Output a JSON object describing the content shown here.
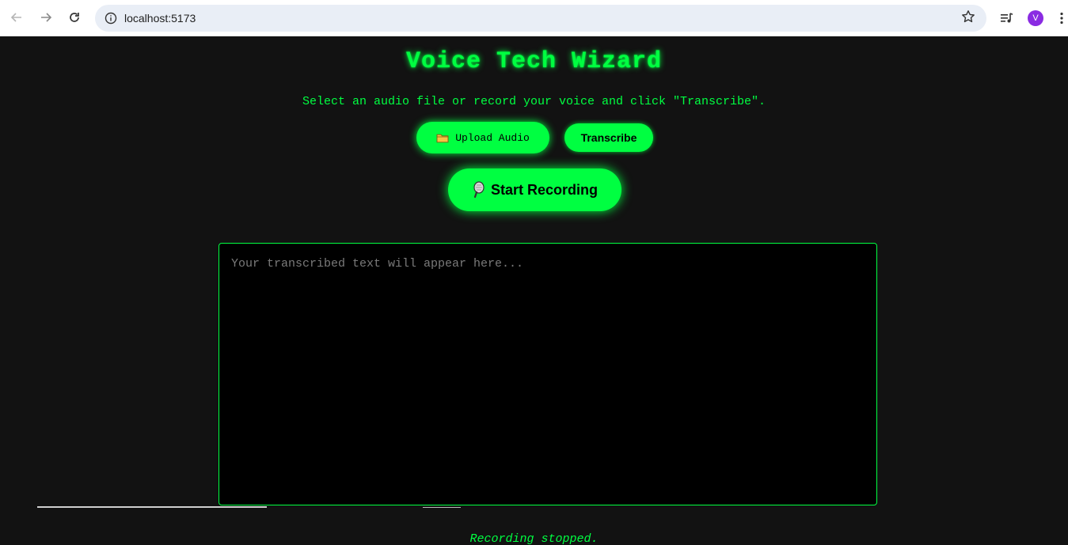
{
  "browser": {
    "url": "localhost:5173",
    "avatar_letter": "V"
  },
  "app": {
    "title": "Voice Tech Wizard",
    "subtitle": "Select an audio file or record your voice and click \"Transcribe\".",
    "upload_label": "Upload Audio",
    "upload_icon": "folder-icon",
    "transcribe_label": "Transcribe",
    "record_label": "Start Recording",
    "record_icon": "microphone-icon",
    "transcript_placeholder": "Your transcribed text will appear here...",
    "transcript_value": "",
    "status": "Recording stopped."
  },
  "colors": {
    "accent": "#00ff41",
    "background": "#121212",
    "textarea_bg": "#000000"
  }
}
